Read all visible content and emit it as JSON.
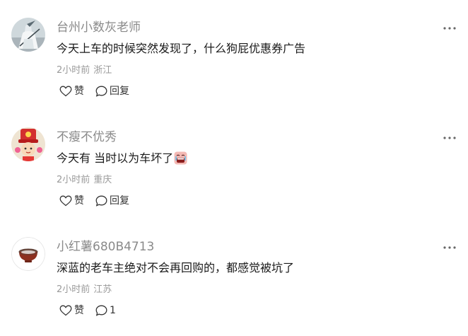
{
  "comments": [
    {
      "username": "台州小数灰老师",
      "text": "今天上车的时候突然发现了，什么狗屁优惠券广告",
      "time": "2小时前",
      "location": "浙江",
      "like_label": "赞",
      "reply_label": "回复",
      "avatar_icon": "avatar-ink-swordsman",
      "more_icon": "more-dots-icon"
    },
    {
      "username": "不瘦不优秀",
      "text": "今天有 当时以为车坏了",
      "emoji": "emoji-crying-face",
      "time": "2小时前",
      "location": "重庆",
      "like_label": "赞",
      "reply_label": "回复",
      "avatar_icon": "avatar-red-hat-character",
      "more_icon": "more-dots-icon"
    },
    {
      "username": "小红薯680B4713",
      "text": "深蓝的老车主绝对不会再回购的，都感觉被坑了",
      "time": "2小时前",
      "location": "江苏",
      "like_label": "赞",
      "reply_label": "1",
      "avatar_icon": "avatar-bowl",
      "more_icon": "more-dots-icon"
    }
  ]
}
